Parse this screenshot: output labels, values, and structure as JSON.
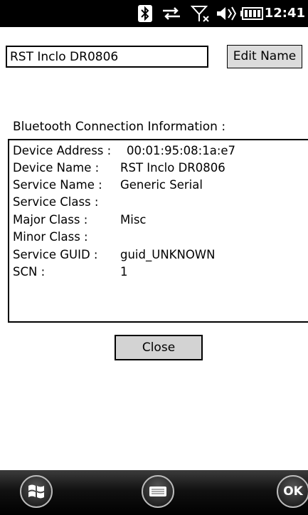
{
  "status_bar": {
    "time": "12:41"
  },
  "device_name_input": {
    "value": "RST Inclo DR0806"
  },
  "edit_name_button": {
    "label": "Edit Name"
  },
  "section_title": "Bluetooth Connection Information :",
  "info_rows": [
    {
      "label": "Device Address :",
      "value": "00:01:95:08:1a:e7"
    },
    {
      "label": "Device Name :",
      "value": "RST Inclo DR0806"
    },
    {
      "label": "Service Name :",
      "value": "Generic Serial"
    },
    {
      "label": "Service Class :",
      "value": ""
    },
    {
      "label": "Major Class :",
      "value": "Misc"
    },
    {
      "label": "Minor Class :",
      "value": ""
    },
    {
      "label": "Service GUID :",
      "value": "guid_UNKNOWN"
    },
    {
      "label": "SCN :",
      "value": "1"
    }
  ],
  "close_button": {
    "label": "Close"
  },
  "soft_keys": {
    "ok_label": "OK"
  },
  "icons": [
    "bluetooth-icon",
    "data-sync-icon",
    "no-signal-icon",
    "volume-icon",
    "battery-icon",
    "windows-start-icon",
    "keyboard-icon"
  ]
}
